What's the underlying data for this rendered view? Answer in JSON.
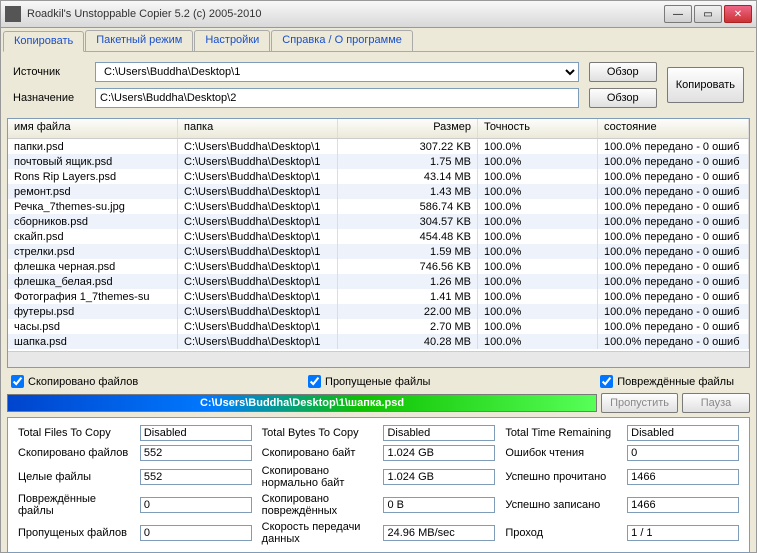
{
  "window": {
    "title": "Roadkil's Unstoppable Copier 5.2 (c) 2005-2010"
  },
  "tabs": [
    {
      "label": "Копировать"
    },
    {
      "label": "Пакетный режим"
    },
    {
      "label": "Настройки"
    },
    {
      "label": "Справка / О программе"
    }
  ],
  "paths": {
    "source_label": "Источник",
    "dest_label": "Назначение",
    "source": "C:\\Users\\Buddha\\Desktop\\1",
    "dest": "C:\\Users\\Buddha\\Desktop\\2",
    "browse": "Обзор",
    "copy": "Копировать"
  },
  "columns": {
    "name": "имя файла",
    "folder": "папка",
    "size": "Размер",
    "accuracy": "Точность",
    "state": "состояние"
  },
  "files": [
    {
      "name": "папки.psd",
      "folder": "C:\\Users\\Buddha\\Desktop\\1",
      "size": "307.22 KB",
      "acc": "100.0%",
      "state": "100.0% передано - 0 ошиб"
    },
    {
      "name": "почтовый ящик.psd",
      "folder": "C:\\Users\\Buddha\\Desktop\\1",
      "size": "1.75 MB",
      "acc": "100.0%",
      "state": "100.0% передано - 0 ошиб"
    },
    {
      "name": "Rons Rip Layers.psd",
      "folder": "C:\\Users\\Buddha\\Desktop\\1",
      "size": "43.14 MB",
      "acc": "100.0%",
      "state": "100.0% передано - 0 ошиб"
    },
    {
      "name": "ремонт.psd",
      "folder": "C:\\Users\\Buddha\\Desktop\\1",
      "size": "1.43 MB",
      "acc": "100.0%",
      "state": "100.0% передано - 0 ошиб"
    },
    {
      "name": "Речка_7themes-su.jpg",
      "folder": "C:\\Users\\Buddha\\Desktop\\1",
      "size": "586.74 KB",
      "acc": "100.0%",
      "state": "100.0% передано - 0 ошиб"
    },
    {
      "name": "сборников.psd",
      "folder": "C:\\Users\\Buddha\\Desktop\\1",
      "size": "304.57 KB",
      "acc": "100.0%",
      "state": "100.0% передано - 0 ошиб"
    },
    {
      "name": "скайп.psd",
      "folder": "C:\\Users\\Buddha\\Desktop\\1",
      "size": "454.48 KB",
      "acc": "100.0%",
      "state": "100.0% передано - 0 ошиб"
    },
    {
      "name": "стрелки.psd",
      "folder": "C:\\Users\\Buddha\\Desktop\\1",
      "size": "1.59 MB",
      "acc": "100.0%",
      "state": "100.0% передано - 0 ошиб"
    },
    {
      "name": "флешка черная.psd",
      "folder": "C:\\Users\\Buddha\\Desktop\\1",
      "size": "746.56 KB",
      "acc": "100.0%",
      "state": "100.0% передано - 0 ошиб"
    },
    {
      "name": "флешка_белая.psd",
      "folder": "C:\\Users\\Buddha\\Desktop\\1",
      "size": "1.26 MB",
      "acc": "100.0%",
      "state": "100.0% передано - 0 ошиб"
    },
    {
      "name": "Фотография 1_7themes-su",
      "folder": "C:\\Users\\Buddha\\Desktop\\1",
      "size": "1.41 MB",
      "acc": "100.0%",
      "state": "100.0% передано - 0 ошиб"
    },
    {
      "name": "футеры.psd",
      "folder": "C:\\Users\\Buddha\\Desktop\\1",
      "size": "22.00 MB",
      "acc": "100.0%",
      "state": "100.0% передано - 0 ошиб"
    },
    {
      "name": "часы.psd",
      "folder": "C:\\Users\\Buddha\\Desktop\\1",
      "size": "2.70 MB",
      "acc": "100.0%",
      "state": "100.0% передано - 0 ошиб"
    },
    {
      "name": "шапка.psd",
      "folder": "C:\\Users\\Buddha\\Desktop\\1",
      "size": "40.28 MB",
      "acc": "100.0%",
      "state": "100.0% передано - 0 ошиб"
    }
  ],
  "checks": {
    "copied": "Скопировано файлов",
    "skipped": "Пропущеные файлы",
    "damaged": "Повреждённые файлы"
  },
  "progress": {
    "current_file": "C:\\Users\\Buddha\\Desktop\\1\\шапка.psd",
    "skip": "Пропустить",
    "pause": "Пауза"
  },
  "stats": {
    "l0": "Total Files To Copy",
    "v0": "Disabled",
    "l1": "Total Bytes To Copy",
    "v1": "Disabled",
    "l2": "Total Time Remaining",
    "v2": "Disabled",
    "l3": "Скопировано файлов",
    "v3": "552",
    "l4": "Скопировано байт",
    "v4": "1.024 GB",
    "l5": "Ошибок чтения",
    "v5": "0",
    "l6": "Целые файлы",
    "v6": "552",
    "l7": "Скопировано нормально байт",
    "v7": "1.024 GB",
    "l8": "Успешно прочитано",
    "v8": "1466",
    "l9": "Повреждённые файлы",
    "v9": "0",
    "l10": "Скопировано повреждённых",
    "v10": "0 B",
    "l11": "Успешно записано",
    "v11": "1466",
    "l12": "Пропущеных файлов",
    "v12": "0",
    "l13": "Скорость передачи данных",
    "v13": "24.96 MB/sec",
    "l14": "Проход",
    "v14": "1 / 1"
  }
}
